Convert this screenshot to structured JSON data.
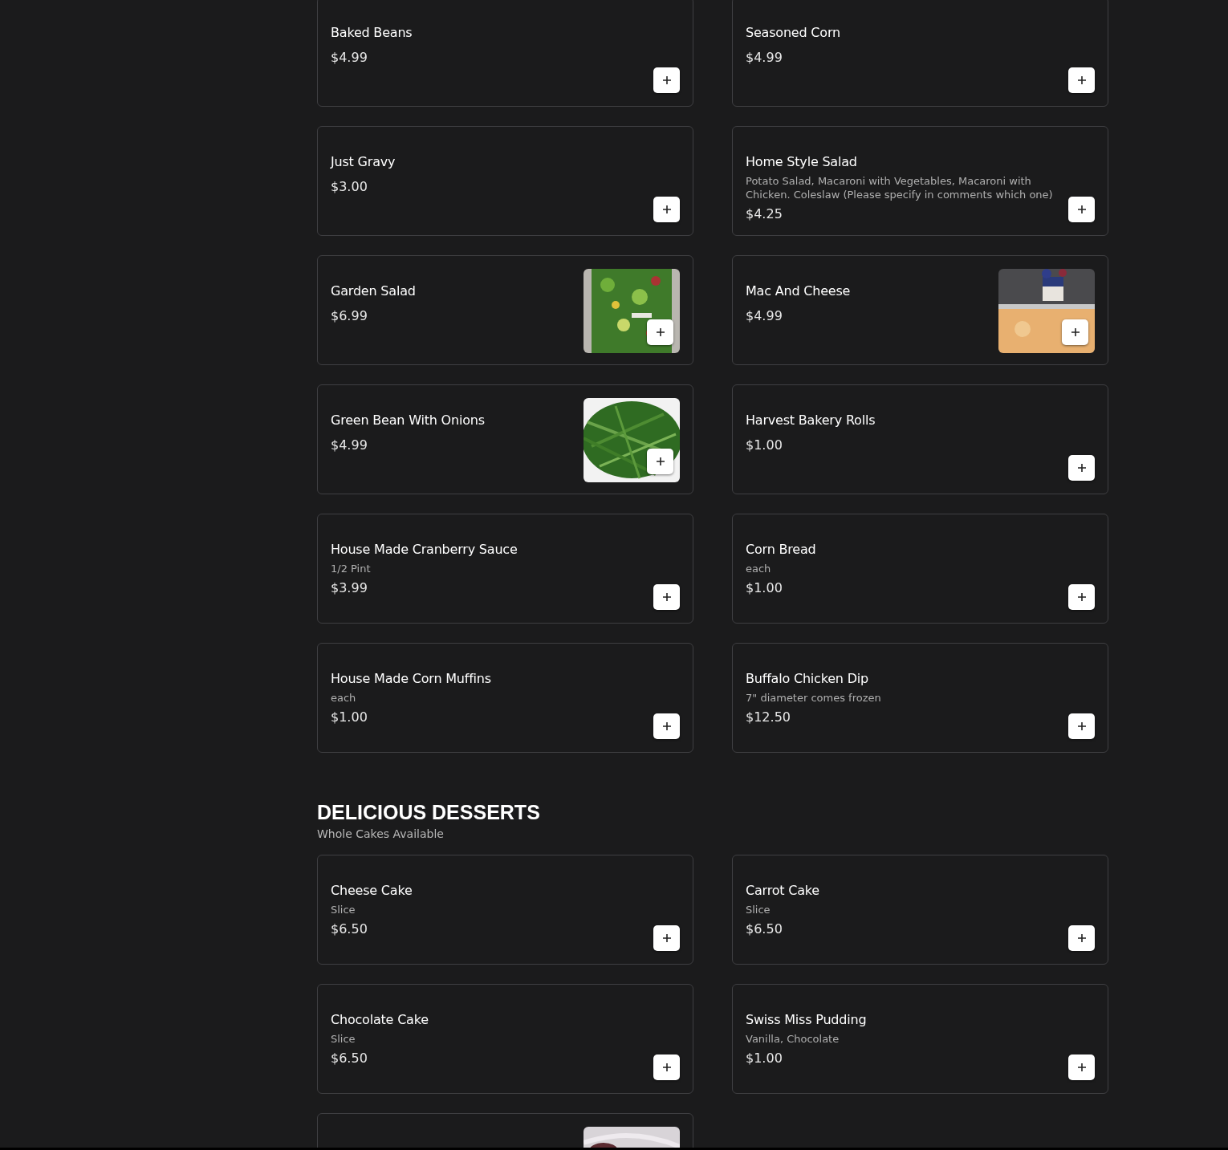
{
  "sections": [
    {
      "items": [
        {
          "name": "Baked Beans",
          "price": "$4.99",
          "image": false
        },
        {
          "name": "Seasoned Corn",
          "price": "$4.99",
          "image": false
        },
        {
          "name": "Just Gravy",
          "price": "$3.00",
          "image": false
        },
        {
          "name": "Home Style Salad",
          "description": "Potato Salad, Macaroni with Vegetables, Macaroni with Chicken. Coleslaw (Please specify in comments which one)",
          "price": "$4.25",
          "image": false
        },
        {
          "name": "Garden Salad",
          "price": "$6.99",
          "image": true
        },
        {
          "name": "Mac And Cheese",
          "price": "$4.99",
          "image": true
        },
        {
          "name": "Green Bean With Onions",
          "price": "$4.99",
          "image": true
        },
        {
          "name": "Harvest Bakery Rolls",
          "price": "$1.00",
          "image": false
        },
        {
          "name": "House Made Cranberry Sauce",
          "description": "1/2 Pint",
          "price": "$3.99",
          "image": false
        },
        {
          "name": "Corn Bread",
          "description": "each",
          "price": "$1.00",
          "image": false
        },
        {
          "name": "House Made Corn Muffins",
          "description": "each",
          "price": "$1.00",
          "image": false
        },
        {
          "name": "Buffalo Chicken Dip",
          "description": "7\" diameter comes frozen",
          "price": "$12.50",
          "image": false
        }
      ]
    },
    {
      "title": "DELICIOUS DESSERTS",
      "subtitle": "Whole Cakes Available",
      "items": [
        {
          "name": "Cheese Cake",
          "description": "Slice",
          "price": "$6.50",
          "image": false
        },
        {
          "name": "Carrot Cake",
          "description": "Slice",
          "price": "$6.50",
          "image": false
        },
        {
          "name": "Chocolate Cake",
          "description": "Slice",
          "price": "$6.50",
          "image": false
        },
        {
          "name": "Swiss Miss Pudding",
          "description": "Vanilla, Chocolate",
          "price": "$1.00",
          "image": false
        },
        {
          "image": true
        }
      ]
    }
  ]
}
